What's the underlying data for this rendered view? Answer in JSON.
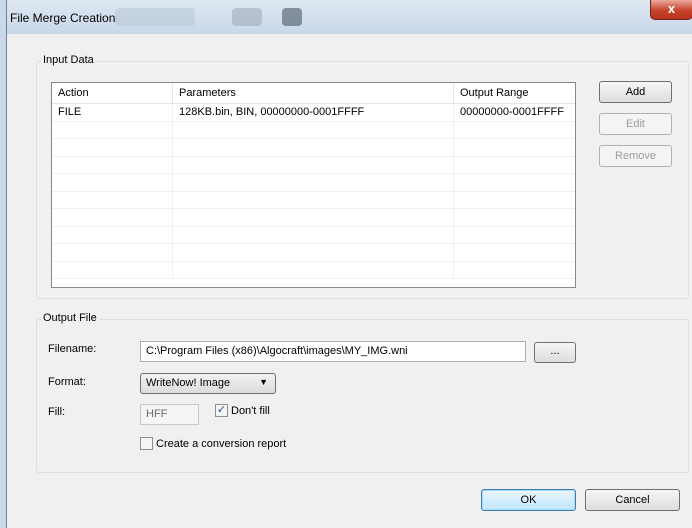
{
  "window": {
    "title": "File Merge Creation",
    "close_glyph": "x"
  },
  "input_data": {
    "group_title": "Input Data",
    "columns": [
      "Action",
      "Parameters",
      "Output Range"
    ],
    "rows": [
      [
        "FILE",
        "128KB.bin, BIN, 00000000-0001FFFF",
        "00000000-0001FFFF"
      ]
    ],
    "buttons": {
      "add": "Add",
      "edit": "Edit",
      "remove": "Remove"
    }
  },
  "output_file": {
    "group_title": "Output File",
    "filename_label": "Filename:",
    "filename_value": "C:\\Program Files (x86)\\Algocraft\\images\\MY_IMG.wni",
    "browse_label": "...",
    "format_label": "Format:",
    "format_value": "WriteNow! Image",
    "fill_label": "Fill:",
    "fill_value": "HFF",
    "dont_fill_label": "Don't fill",
    "dont_fill_checked": true,
    "report_label": "Create a conversion report",
    "report_checked": false
  },
  "footer": {
    "ok": "OK",
    "cancel": "Cancel"
  }
}
